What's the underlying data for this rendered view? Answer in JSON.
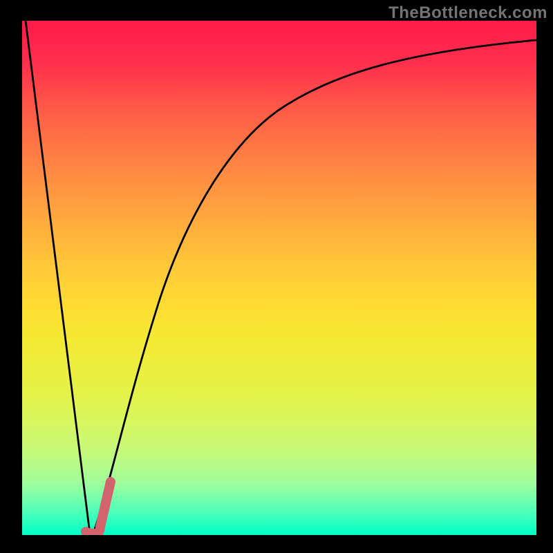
{
  "watermark": "TheBottleneck.com",
  "chart_data": {
    "type": "line",
    "title": "",
    "xlabel": "",
    "ylabel": "",
    "xlim": [
      0,
      100
    ],
    "ylim": [
      0,
      100
    ],
    "series": [
      {
        "name": "bottleneck-curve",
        "x": [
          0,
          13,
          14,
          15,
          20,
          28,
          37,
          45,
          55,
          65,
          78,
          90,
          100
        ],
        "values": [
          100,
          0,
          0,
          3,
          20,
          45,
          65,
          77,
          85,
          90,
          93,
          95,
          96
        ]
      },
      {
        "name": "marker-j",
        "x": [
          12.5,
          14.5,
          17.5
        ],
        "values": [
          0.5,
          0.5,
          10.5
        ]
      }
    ],
    "gradient_colors": {
      "top": "#FF1B48",
      "bottom": "#00FFC8"
    },
    "marker_color": "#D1646D"
  }
}
